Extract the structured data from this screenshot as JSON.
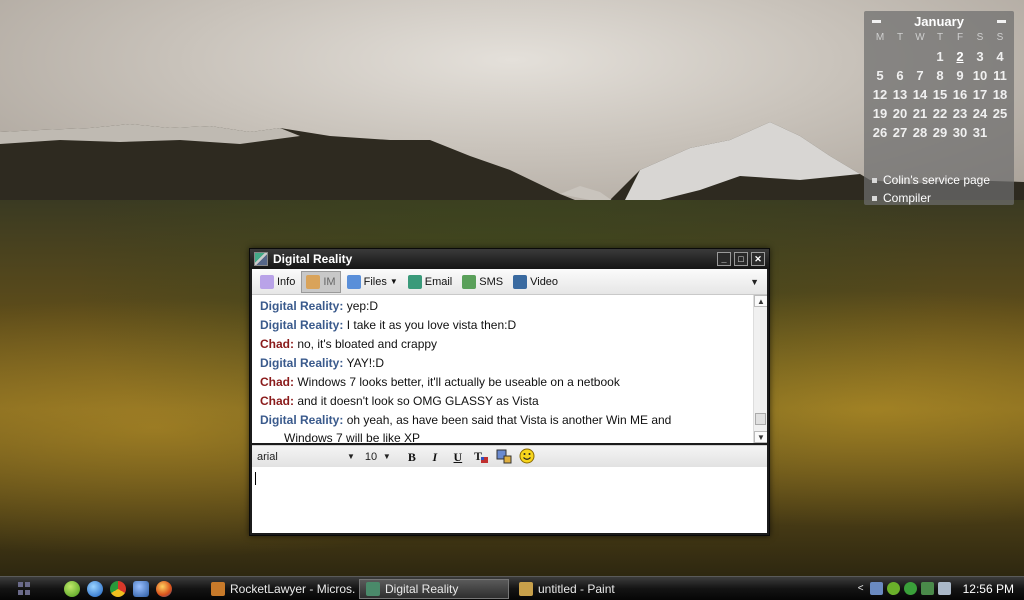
{
  "calendar": {
    "month": "January",
    "weekdays": [
      "M",
      "T",
      "W",
      "T",
      "F",
      "S",
      "S"
    ],
    "days": [
      "",
      "",
      "",
      "1",
      "2",
      "3",
      "4",
      "5",
      "6",
      "7",
      "8",
      "9",
      "10",
      "11",
      "12",
      "13",
      "14",
      "15",
      "16",
      "17",
      "18",
      "19",
      "20",
      "21",
      "22",
      "23",
      "24",
      "25",
      "26",
      "27",
      "28",
      "29",
      "30",
      "31",
      ""
    ],
    "today": "2",
    "links": [
      "Colin's service page",
      "Compiler"
    ]
  },
  "window": {
    "title": "Digital Reality",
    "buttons": {
      "minimize": "_",
      "maximize": "□",
      "close": "✕"
    },
    "toolbar": [
      {
        "label": "Info",
        "icon": "lightbulb-icon",
        "color": "#b9a3e8"
      },
      {
        "label": "IM",
        "icon": "pencil-icon",
        "color": "#d9a35a",
        "active": true
      },
      {
        "label": "Files",
        "icon": "files-icon",
        "color": "#5a8fd9",
        "dropdown": true
      },
      {
        "label": "Email",
        "icon": "email-icon",
        "color": "#3a9a7a"
      },
      {
        "label": "SMS",
        "icon": "phone-icon",
        "color": "#5aa05a"
      },
      {
        "label": "Video",
        "icon": "webcam-icon",
        "color": "#3a6aa0"
      }
    ],
    "messages": [
      {
        "who": "Digital Reality:",
        "side": "dr",
        "text": " yep:D"
      },
      {
        "who": "Digital Reality:",
        "side": "dr",
        "text": " I take it as you love vista then:D"
      },
      {
        "who": "Chad:",
        "side": "chad",
        "text": " no, it's bloated and crappy"
      },
      {
        "who": "Digital Reality:",
        "side": "dr",
        "text": " YAY!:D"
      },
      {
        "who": "Chad:",
        "side": "chad",
        "text": " Windows 7 looks better, it'll actually be useable on a netbook"
      },
      {
        "who": "Chad:",
        "side": "chad",
        "text": " and it doesn't look so OMG GLASSY as Vista"
      },
      {
        "who": "Digital Reality:",
        "side": "dr",
        "text": " oh yeah, as have been said that Vista is another Win ME and",
        "cont": "Windows 7 will be like XP"
      }
    ],
    "format": {
      "font": "arial",
      "size": "10",
      "bold": "B",
      "italic": "I",
      "underline": "U"
    }
  },
  "taskbar": {
    "tasks": [
      {
        "label": "RocketLawyer - Micros...",
        "color": "#c87a2a"
      },
      {
        "label": "Digital Reality",
        "color": "#4a8a6a",
        "active": true
      },
      {
        "label": "untitled - Paint",
        "color": "#c8a04a"
      }
    ],
    "clock": "12:56 PM"
  }
}
